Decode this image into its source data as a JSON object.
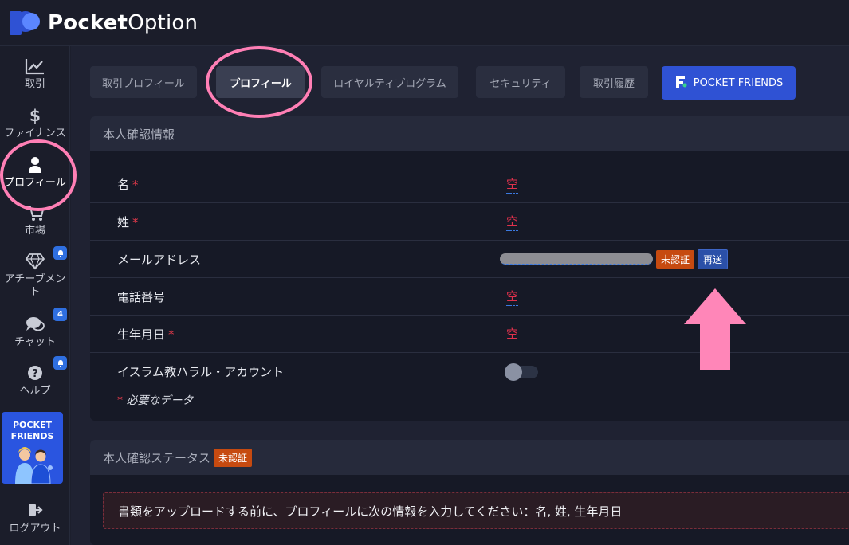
{
  "app": {
    "brand_bold": "Pocket",
    "brand_light": "Option"
  },
  "sidebar": {
    "items": [
      {
        "label": "取引",
        "icon": "chart-line-icon"
      },
      {
        "label": "ファイナンス",
        "icon": "dollar-icon"
      },
      {
        "label": "プロフィール",
        "icon": "user-icon"
      },
      {
        "label": "市場",
        "icon": "cart-icon"
      },
      {
        "label": "アチーブメント",
        "icon": "diamond-icon",
        "badge": ""
      },
      {
        "label": "チャット",
        "icon": "chat-icon",
        "badge": "4"
      },
      {
        "label": "ヘルプ",
        "icon": "help-icon",
        "badge": ""
      }
    ],
    "promo": {
      "line1": "POCKET",
      "line2": "FRIENDS"
    },
    "logout": "ログアウト"
  },
  "tabs": [
    "取引プロフィール",
    "プロフィール",
    "ロイヤルティプログラム",
    "セキュリティ",
    "取引履歴",
    "POCKET FRIENDS"
  ],
  "identity": {
    "title": "本人確認情報",
    "rows": [
      {
        "label": "名",
        "required": "*",
        "value": "空"
      },
      {
        "label": "姓",
        "required": "*",
        "value": "空"
      },
      {
        "label": "メールアドレス",
        "required": "",
        "status": "未認証",
        "action": "再送"
      },
      {
        "label": "電話番号",
        "required": "",
        "value": "空"
      },
      {
        "label": "生年月日",
        "required": "*",
        "value": "空"
      },
      {
        "label": "イスラム教ハラル・アカウント",
        "required": ""
      }
    ],
    "note_star": "*",
    "note": "必要なデータ"
  },
  "status": {
    "title": "本人確認ステータス",
    "badge": "未認証",
    "warning": "書類をアップロードする前に、プロフィールに次の情報を入力してください：名, 姓, 生年月日"
  },
  "colors": {
    "accent_blue": "#2f52d4",
    "required_red": "#e53a4b",
    "badge_orange": "#c64a10",
    "annotation_pink": "#ff7fb5"
  }
}
